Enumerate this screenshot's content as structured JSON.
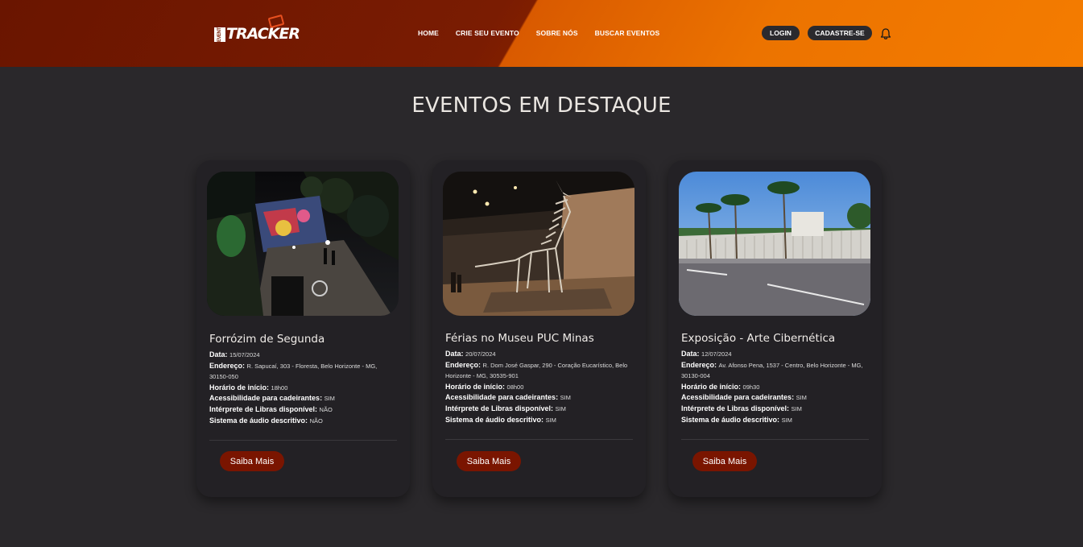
{
  "header": {
    "logo_badge": "EVENT",
    "logo_text": "TRACKER",
    "nav": [
      {
        "label": "HOME"
      },
      {
        "label": "CRIE SEU EVENTO"
      },
      {
        "label": "SOBRE NÓS"
      },
      {
        "label": "BUSCAR EVENTOS"
      }
    ],
    "login_label": "LOGIN",
    "signup_label": "CADASTRE-SE"
  },
  "main": {
    "heading": "EVENTOS EM DESTAQUE",
    "labels": {
      "date": "Data:",
      "address": "Endereço:",
      "start_time": "Horário de início:",
      "wheelchair": "Acessibilidade para cadeirantes:",
      "libras": "Intérprete de Libras disponível:",
      "audio": "Sistema de áudio descritivo:",
      "more": "Saiba Mais"
    },
    "events": [
      {
        "title": "Forrózim de Segunda",
        "date": "15/07/2024",
        "address": "R. Sapucaí, 303 - Floresta, Belo Horizonte - MG, 30150-050",
        "start_time": "18h00",
        "wheelchair": "SIM",
        "libras": "NÃO",
        "audio": "NÃO"
      },
      {
        "title": "Férias no Museu PUC Minas",
        "date": "20/07/2024",
        "address": "R. Dom José Gaspar, 290 - Coração Eucarístico, Belo Horizonte - MG, 30535-901",
        "start_time": "08h00",
        "wheelchair": "SIM",
        "libras": "SIM",
        "audio": "SIM"
      },
      {
        "title": "Exposição - Arte Cibernética",
        "date": "12/07/2024",
        "address": "Av. Afonso Pena, 1537 - Centro, Belo Horizonte - MG, 30130-004",
        "start_time": "09h30",
        "wheelchair": "SIM",
        "libras": "SIM",
        "audio": "SIM"
      }
    ]
  },
  "colors": {
    "header_dark": "#7a1c02",
    "header_orange": "#f47c00",
    "background": "#2a282b",
    "card": "#232125",
    "button": "#7a1500"
  }
}
